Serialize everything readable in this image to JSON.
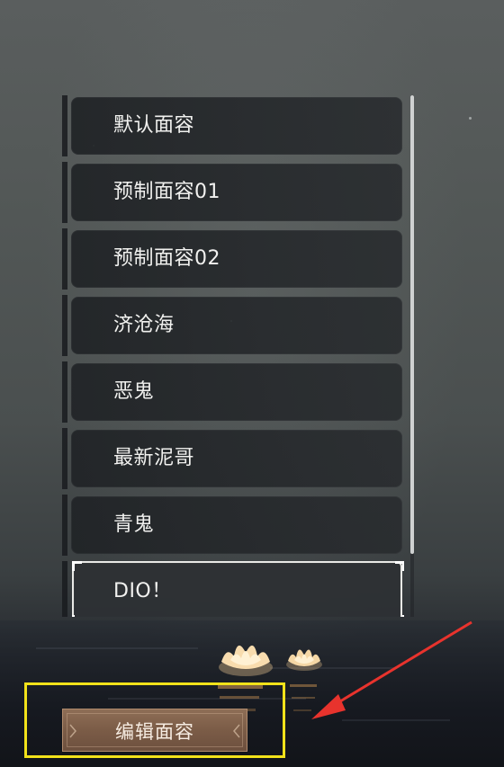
{
  "face_list": {
    "items": [
      {
        "label": "默认面容",
        "selected": false
      },
      {
        "label": "预制面容01",
        "selected": false
      },
      {
        "label": "预制面容02",
        "selected": false
      },
      {
        "label": "济沧海",
        "selected": false
      },
      {
        "label": "恶鬼",
        "selected": false
      },
      {
        "label": "最新泥哥",
        "selected": false
      },
      {
        "label": "青鬼",
        "selected": false
      },
      {
        "label": "DIO！",
        "selected": true
      }
    ]
  },
  "edit_button": {
    "label": "编辑面容"
  },
  "annotation": {
    "highlight_color": "#f2e21a",
    "arrow_color": "#e8332d"
  }
}
